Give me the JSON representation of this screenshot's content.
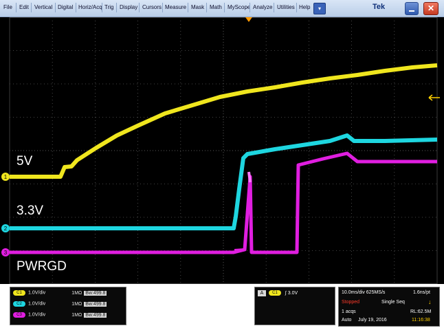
{
  "menu": {
    "items": [
      "File",
      "Edit",
      "Vertical",
      "Digital",
      "Horiz/Acq",
      "Trig",
      "Display",
      "Cursors",
      "Measure",
      "Mask",
      "Math",
      "MyScope",
      "Analyze",
      "Utilities",
      "Help"
    ],
    "dropdown_glyph": "▾",
    "brand": "Tek",
    "close_glyph": "✕"
  },
  "screen": {
    "labels": {
      "five_v": "5V",
      "three_three_v": "3.3V",
      "pwrgd": "PWRGD"
    },
    "markers": {
      "ch1": "1",
      "ch2": "2",
      "ch3": "3"
    },
    "colors": {
      "ch1": "#f0e61e",
      "ch2": "#1ed6e0",
      "ch3": "#e01ee0",
      "grid": "#5a5a5a",
      "trigger": "#ff9a00"
    }
  },
  "channels": [
    {
      "badge": "C1",
      "scale": "1.0V/div",
      "impedance": "1MΩ",
      "bandwidth": "Bw:499.8",
      "color": "#f0e61e"
    },
    {
      "badge": "C2",
      "scale": "1.0V/div",
      "impedance": "1MΩ",
      "bandwidth": "Bw:499.8",
      "color": "#1ed6e0"
    },
    {
      "badge": "C3",
      "scale": "1.0V/div",
      "impedance": "1MΩ",
      "bandwidth": "Bw:499.8",
      "color": "#e01ee0"
    }
  ],
  "trigger": {
    "mode": "A",
    "source": "C1",
    "slope_glyph": "∫",
    "level": "3.0V"
  },
  "acquisition": {
    "timebase": "10.0ms/div 625MS/s",
    "resolution": "1.6ns/pt",
    "state": "Stopped",
    "seq": "Single Seq",
    "acqs": "1 acqs",
    "record_length": "RL:62.5M",
    "mode": "Auto",
    "date": "July 19, 2016",
    "time": "11:16:38"
  }
}
